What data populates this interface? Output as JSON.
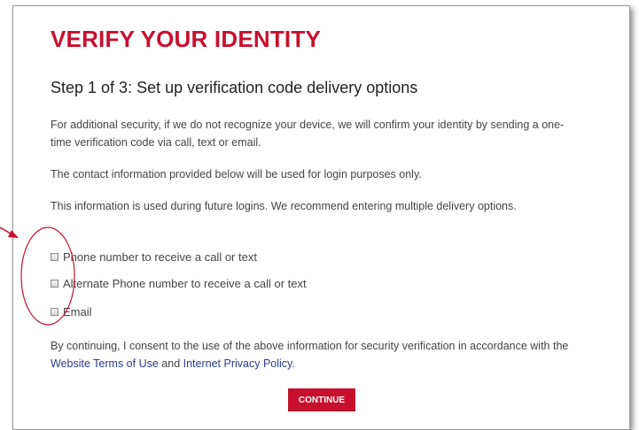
{
  "page": {
    "title": "VERIFY YOUR IDENTITY",
    "step_heading": "Step 1 of 3: Set up verification code delivery options"
  },
  "paragraphs": [
    "For additional security, if we do not recognize your device, we will confirm your identity by sending a one-time verification code via call, text or email.",
    "The contact information provided below will be used for login purposes only.",
    "This information is used during future logins. We recommend entering multiple delivery options."
  ],
  "options": [
    {
      "label": "Phone number to receive a call or text",
      "checked": false
    },
    {
      "label": "Alternate Phone number to receive a call or text",
      "checked": false
    },
    {
      "label": "Email",
      "checked": false
    }
  ],
  "consent": {
    "text_before": "By continuing, I consent to the use of the above information for security verification in accordance with the ",
    "link1": "Website Terms of Use",
    "middle": " and ",
    "link2": "Internet Privacy Policy",
    "text_after": "."
  },
  "buttons": {
    "continue_label": "CONTINUE"
  },
  "colors": {
    "brand_red": "#c8102e",
    "link_blue": "#2c3a8c",
    "annotation_red": "#c8102e"
  }
}
